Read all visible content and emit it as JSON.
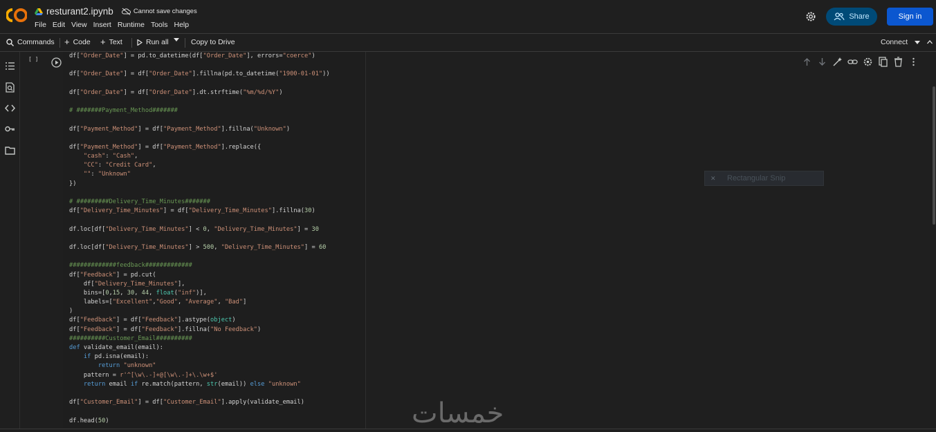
{
  "header": {
    "notebook_title": "resturant2.ipynb",
    "save_status": "Cannot save changes",
    "menu": [
      "File",
      "Edit",
      "View",
      "Insert",
      "Runtime",
      "Tools",
      "Help"
    ],
    "share_label": "Share",
    "signin_label": "Sign in"
  },
  "toolbar": {
    "commands": "Commands",
    "code": "Code",
    "text": "Text",
    "run_all": "Run all",
    "copy_to_drive": "Copy to Drive",
    "connect": "Connect"
  },
  "cell": {
    "execution_count": "[ ]",
    "lines": [
      "df[\"Order_Date\"] = pd.to_datetime(df[\"Order_Date\"], errors=\"coerce\")",
      "",
      "df[\"Order_Date\"] = df[\"Order_Date\"].fillna(pd.to_datetime(\"1900-01-01\"))",
      "",
      "df[\"Order_Date\"] = df[\"Order_Date\"].dt.strftime(\"%m/%d/%Y\")",
      "",
      "# #######Payment_Method#######",
      "",
      "df[\"Payment_Method\"] = df[\"Payment_Method\"].fillna(\"Unknown\")",
      "",
      "df[\"Payment_Method\"] = df[\"Payment_Method\"].replace({",
      "    \"cash\": \"Cash\",",
      "    \"CC\": \"Credit Card\",",
      "    \"\": \"Unknown\"",
      "})",
      "",
      "# #########Delivery_Time_Minutes#######",
      "df[\"Delivery_Time_Minutes\"] = df[\"Delivery_Time_Minutes\"].fillna(30)",
      "",
      "df.loc[df[\"Delivery_Time_Minutes\"] < 0, \"Delivery_Time_Minutes\"] = 30",
      "",
      "df.loc[df[\"Delivery_Time_Minutes\"] > 500, \"Delivery_Time_Minutes\"] = 60",
      "",
      "#############feedback#############",
      "df[\"Feedback\"] = pd.cut(",
      "    df[\"Delivery_Time_Minutes\"],",
      "    bins=[0,15, 30, 44, float(\"inf\")],",
      "    labels=[\"Excellent\",\"Good\", \"Average\", \"Bad\"]",
      ")",
      "df[\"Feedback\"] = df[\"Feedback\"].astype(object)",
      "df[\"Feedback\"] = df[\"Feedback\"].fillna(\"No Feedback\")",
      "##########Customer_Email##########",
      "def validate_email(email):",
      "    if pd.isna(email):",
      "        return \"unknown\"",
      "    pattern = r'^[\\w\\.-]+@[\\w\\.-]+\\.\\w+$'",
      "    return email if re.match(pattern, str(email)) else \"unknown\"",
      "",
      "df[\"Customer_Email\"] = df[\"Customer_Email\"].apply(validate_email)",
      "",
      "df.head(50)"
    ]
  },
  "overlay": {
    "snip_label": "Rectangular Snip",
    "snip_close": "✕",
    "watermark": "خمسات"
  },
  "colors": {
    "background": "#1f1f1f",
    "editor": "#1e1e1e",
    "share_bg": "#004a77",
    "signin_bg": "#0b57d0",
    "logo_orange": "#f9ab00"
  }
}
